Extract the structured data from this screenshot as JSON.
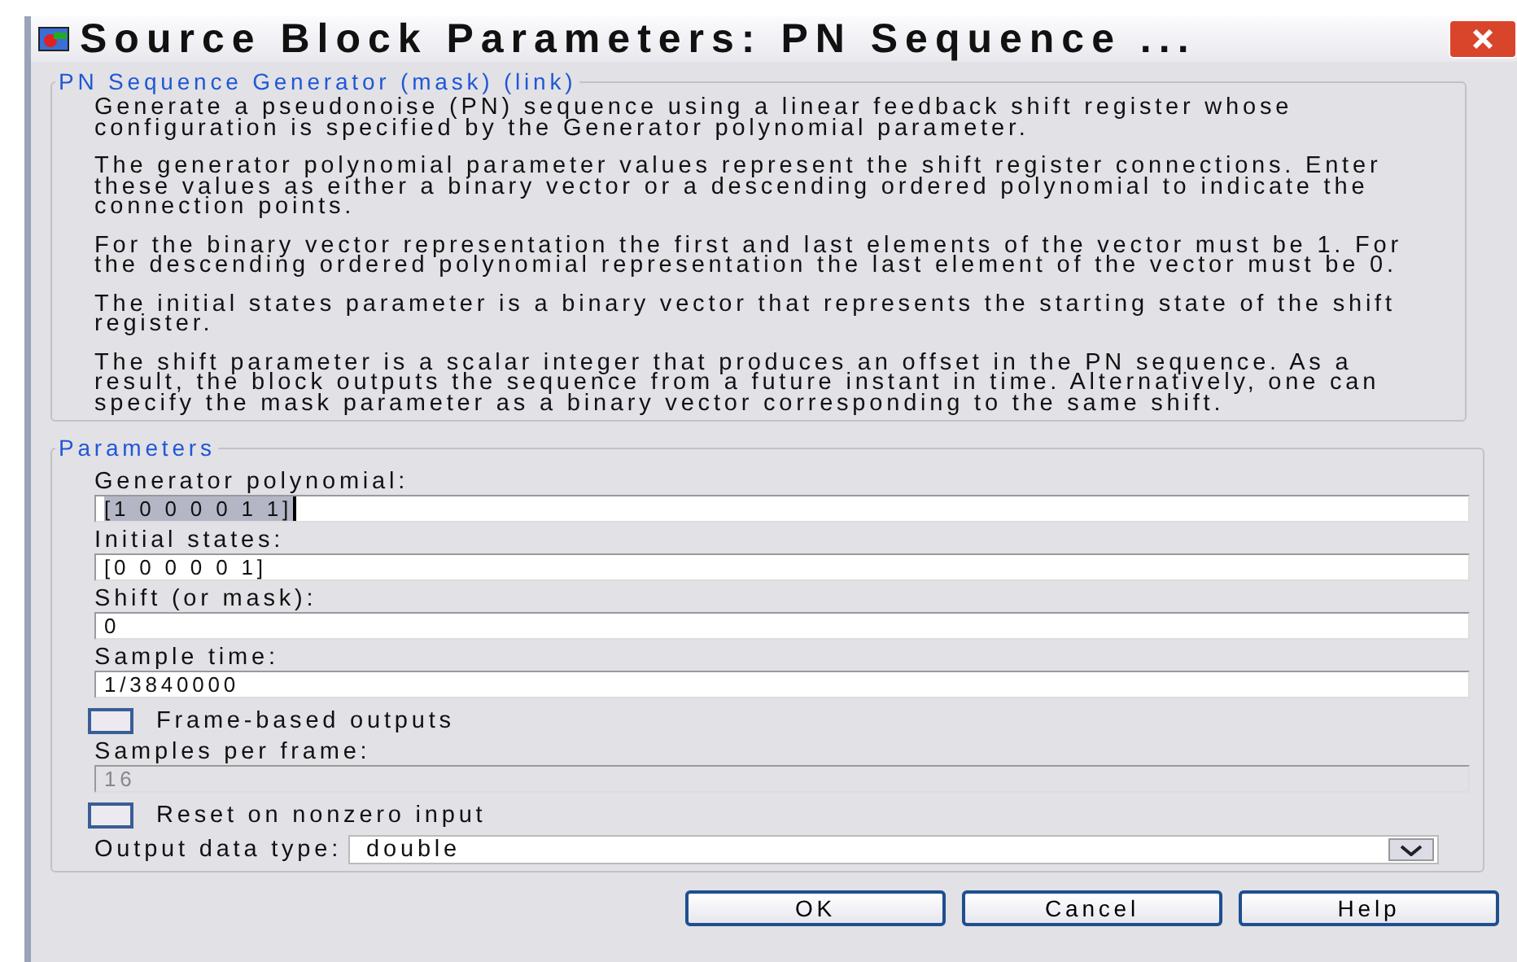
{
  "window": {
    "title": "Source Block Parameters: PN Sequence ..."
  },
  "description": {
    "legend": "PN Sequence Generator (mask) (link)",
    "paragraphs": [
      "Generate a pseudonoise (PN) sequence using a linear feedback shift register whose configuration is specified by the Generator polynomial parameter.",
      "The generator polynomial parameter values represent the shift register connections. Enter these values as either a binary vector or a descending ordered polynomial to indicate the connection points.",
      "For the binary vector representation the first and last elements of the vector must be 1. For the descending ordered polynomial representation the last element of the vector must be 0.",
      "The initial states parameter is a binary vector that represents the starting state of the shift register.",
      "The shift parameter is a scalar integer that produces an offset in the PN sequence. As a result, the block outputs the sequence from a future instant in time. Alternatively, one can specify the mask parameter as a binary vector corresponding to the same shift."
    ]
  },
  "parameters": {
    "legend": "Parameters",
    "items": [
      {
        "kind": "field",
        "label": "Generator polynomial:",
        "value": "[1 0 0 0 0 1 1]",
        "highlighted": true,
        "disabled": false
      },
      {
        "kind": "field",
        "label": "Initial states:",
        "value": "[0 0 0 0 0 1]",
        "highlighted": false,
        "disabled": false
      },
      {
        "kind": "field",
        "label": "Shift (or mask):",
        "value": "0",
        "highlighted": false,
        "disabled": false
      },
      {
        "kind": "field",
        "label": "Sample time:",
        "value": "1/3840000",
        "highlighted": false,
        "disabled": false
      },
      {
        "kind": "checkbox",
        "label": "Frame-based outputs",
        "checked": false
      },
      {
        "kind": "field",
        "label": "Samples per frame:",
        "value": "16",
        "highlighted": false,
        "disabled": true
      },
      {
        "kind": "checkbox",
        "label": "Reset on nonzero input",
        "checked": false
      },
      {
        "kind": "dropdown",
        "label": "Output data type:",
        "value": "double"
      }
    ]
  },
  "buttons": [
    "OK",
    "Cancel",
    "Help"
  ]
}
